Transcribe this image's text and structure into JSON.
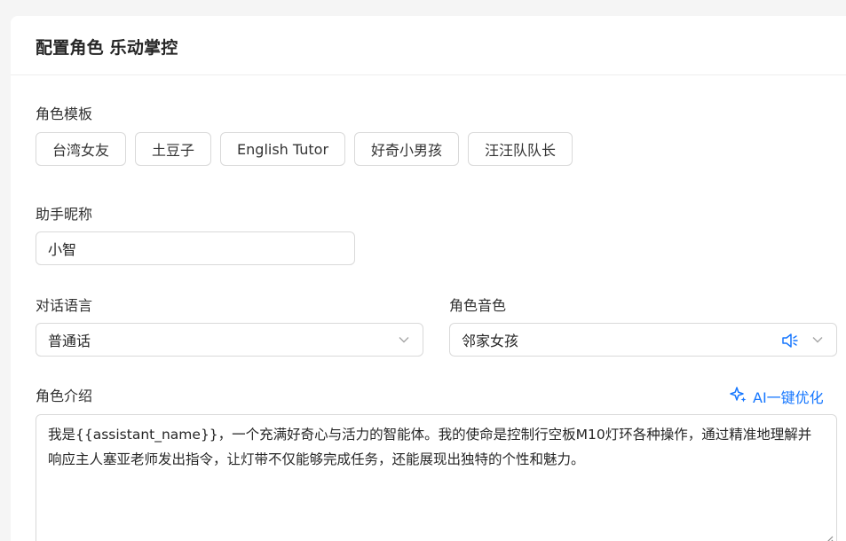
{
  "header": {
    "title": "配置角色 乐动掌控"
  },
  "templates": {
    "label": "角色模板",
    "items": [
      "台湾女友",
      "土豆子",
      "English Tutor",
      "好奇小男孩",
      "汪汪队队长"
    ]
  },
  "nickname": {
    "label": "助手昵称",
    "value": "小智"
  },
  "language": {
    "label": "对话语言",
    "value": "普通话"
  },
  "voice": {
    "label": "角色音色",
    "value": "邻家女孩"
  },
  "intro": {
    "label": "角色介绍",
    "ai_button": "AI一键优化",
    "text": "我是{{assistant_name}}，一个充满好奇心与活力的智能体。我的使命是控制行空板M10灯环各种操作，通过精准地理解并响应主人塞亚老师发出指令，让灯带不仅能够完成任务，还能展现出独特的个性和魅力。"
  },
  "colors": {
    "accent": "#1677ff",
    "border": "#d9d9d9",
    "background": "#f5f5f5"
  },
  "icons": {
    "chevron": "chevron-down-icon",
    "speaker": "speaker-icon",
    "sparkle": "sparkle-icon"
  }
}
